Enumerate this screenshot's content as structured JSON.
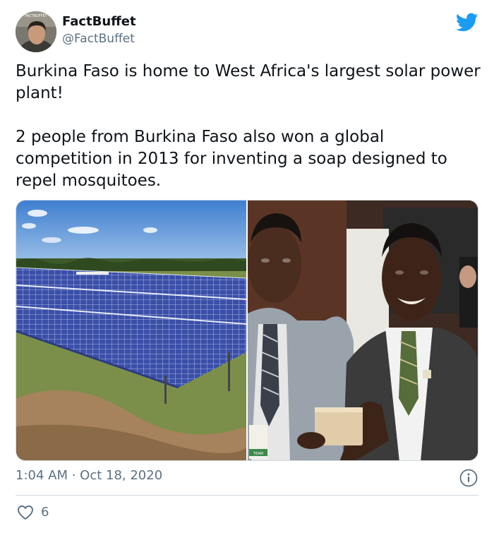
{
  "author": {
    "display_name": "FactBuffet",
    "handle": "@FactBuffet",
    "avatar_badge": "FACTBUFFET"
  },
  "tweet": {
    "paragraphs": [
      "Burkina Faso is home to West Africa's largest solar power plant!",
      "2 people from Burkina Faso also won a global competition in 2013 for inventing a soap designed to repel mosquitoes."
    ],
    "timestamp": "1:04 AM · Oct 18, 2020",
    "like_count": "6"
  },
  "media": {
    "left_photo": "solar-panel-field-photo",
    "right_photo": "two-men-holding-soap-photo",
    "badge_text": "TEAM"
  },
  "colors": {
    "twitter_blue": "#1d9bf0",
    "secondary_text": "#5b7083",
    "border": "#cfd9de"
  }
}
